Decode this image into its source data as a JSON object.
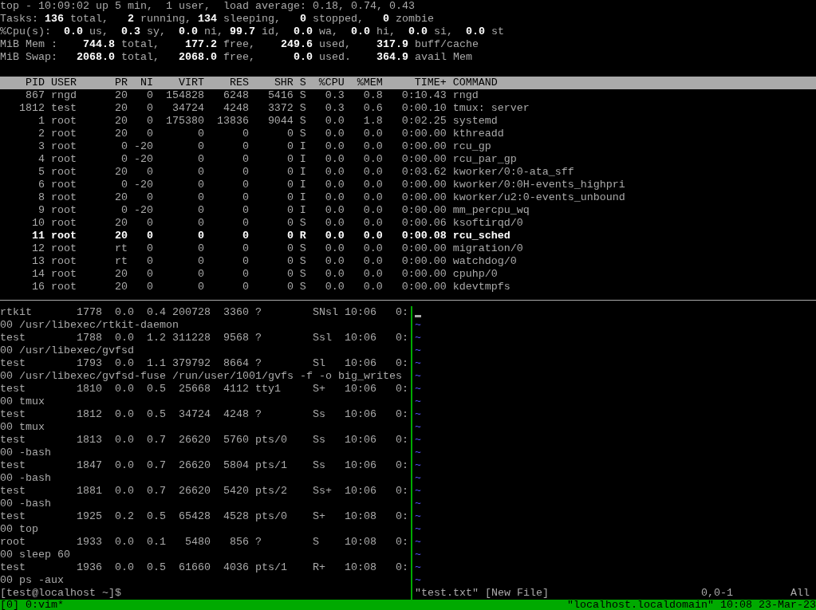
{
  "top": {
    "summary": [
      "top - 10:09:02 up 5 min,  1 user,  load average: 0.18, 0.74, 0.43",
      "Tasks: **136** total,   **2** running, **134** sleeping,   **0** stopped,   **0** zombie",
      "%Cpu(s):  **0.0** us,  **0.3** sy,  **0.0** ni, **99.7** id,  **0.0** wa,  **0.0** hi,  **0.0** si,  **0.0** st",
      "MiB Mem :    **744.8** total,    **177.2** free,    **249.6** used,    **317.9** buff/cache",
      "MiB Swap:   **2068.0** total,   **2068.0** free,      **0.0** used.    **364.9** avail Mem"
    ],
    "columns": [
      "PID",
      "USER",
      "PR",
      "NI",
      "VIRT",
      "RES",
      "SHR",
      "S",
      "%CPU",
      "%MEM",
      "TIME+",
      "COMMAND"
    ],
    "rows": [
      {
        "cells": [
          "867",
          "rngd",
          "20",
          "0",
          "154828",
          "6248",
          "5416",
          "S",
          "0.3",
          "0.8",
          "0:10.43",
          "rngd"
        ],
        "running": false
      },
      {
        "cells": [
          "1812",
          "test",
          "20",
          "0",
          "34724",
          "4248",
          "3372",
          "S",
          "0.3",
          "0.6",
          "0:00.10",
          "tmux: server"
        ],
        "running": false
      },
      {
        "cells": [
          "1",
          "root",
          "20",
          "0",
          "175380",
          "13836",
          "9044",
          "S",
          "0.0",
          "1.8",
          "0:02.25",
          "systemd"
        ],
        "running": false
      },
      {
        "cells": [
          "2",
          "root",
          "20",
          "0",
          "0",
          "0",
          "0",
          "S",
          "0.0",
          "0.0",
          "0:00.00",
          "kthreadd"
        ],
        "running": false
      },
      {
        "cells": [
          "3",
          "root",
          "0",
          "-20",
          "0",
          "0",
          "0",
          "I",
          "0.0",
          "0.0",
          "0:00.00",
          "rcu_gp"
        ],
        "running": false
      },
      {
        "cells": [
          "4",
          "root",
          "0",
          "-20",
          "0",
          "0",
          "0",
          "I",
          "0.0",
          "0.0",
          "0:00.00",
          "rcu_par_gp"
        ],
        "running": false
      },
      {
        "cells": [
          "5",
          "root",
          "20",
          "0",
          "0",
          "0",
          "0",
          "I",
          "0.0",
          "0.0",
          "0:03.62",
          "kworker/0:0-ata_sff"
        ],
        "running": false
      },
      {
        "cells": [
          "6",
          "root",
          "0",
          "-20",
          "0",
          "0",
          "0",
          "I",
          "0.0",
          "0.0",
          "0:00.00",
          "kworker/0:0H-events_highpri"
        ],
        "running": false
      },
      {
        "cells": [
          "8",
          "root",
          "20",
          "0",
          "0",
          "0",
          "0",
          "I",
          "0.0",
          "0.0",
          "0:00.00",
          "kworker/u2:0-events_unbound"
        ],
        "running": false
      },
      {
        "cells": [
          "9",
          "root",
          "0",
          "-20",
          "0",
          "0",
          "0",
          "I",
          "0.0",
          "0.0",
          "0:00.00",
          "mm_percpu_wq"
        ],
        "running": false
      },
      {
        "cells": [
          "10",
          "root",
          "20",
          "0",
          "0",
          "0",
          "0",
          "S",
          "0.0",
          "0.0",
          "0:00.06",
          "ksoftirqd/0"
        ],
        "running": false
      },
      {
        "cells": [
          "11",
          "root",
          "20",
          "0",
          "0",
          "0",
          "0",
          "R",
          "0.0",
          "0.0",
          "0:00.08",
          "rcu_sched"
        ],
        "running": true
      },
      {
        "cells": [
          "12",
          "root",
          "rt",
          "0",
          "0",
          "0",
          "0",
          "S",
          "0.0",
          "0.0",
          "0:00.00",
          "migration/0"
        ],
        "running": false
      },
      {
        "cells": [
          "13",
          "root",
          "rt",
          "0",
          "0",
          "0",
          "0",
          "S",
          "0.0",
          "0.0",
          "0:00.00",
          "watchdog/0"
        ],
        "running": false
      },
      {
        "cells": [
          "14",
          "root",
          "20",
          "0",
          "0",
          "0",
          "0",
          "S",
          "0.0",
          "0.0",
          "0:00.00",
          "cpuhp/0"
        ],
        "running": false
      },
      {
        "cells": [
          "16",
          "root",
          "20",
          "0",
          "0",
          "0",
          "0",
          "S",
          "0.0",
          "0.0",
          "0:00.00",
          "kdevtmpfs"
        ],
        "running": false
      }
    ]
  },
  "shell": {
    "lines": [
      "rtkit       1778  0.0  0.4 200728  3360 ?        SNsl 10:06   0:",
      "00 /usr/libexec/rtkit-daemon",
      "test        1788  0.0  1.2 311228  9568 ?        Ssl  10:06   0:",
      "00 /usr/libexec/gvfsd",
      "test        1793  0.0  1.1 379792  8664 ?        Sl   10:06   0:",
      "00 /usr/libexec/gvfsd-fuse /run/user/1001/gvfs -f -o big_writes",
      "test        1810  0.0  0.5  25668  4112 tty1     S+   10:06   0:",
      "00 tmux",
      "test        1812  0.0  0.5  34724  4248 ?        Ss   10:06   0:",
      "00 tmux",
      "test        1813  0.0  0.7  26620  5760 pts/0    Ss   10:06   0:",
      "00 -bash",
      "test        1847  0.0  0.7  26620  5804 pts/1    Ss   10:06   0:",
      "00 -bash",
      "test        1881  0.0  0.7  26620  5420 pts/2    Ss+  10:06   0:",
      "00 -bash",
      "test        1925  0.2  0.5  65428  4528 pts/0    S+   10:08   0:",
      "00 top",
      "root        1933  0.0  0.1   5480   856 ?        S    10:08   0:",
      "00 sleep 60",
      "test        1936  0.0  0.5  61660  4036 pts/1    R+   10:08   0:",
      "00 ps -aux",
      "[test@localhost ~]$"
    ]
  },
  "vim": {
    "active": true,
    "tildes": [
      "~",
      "~",
      "~",
      "~",
      "~",
      "~",
      "~",
      "~",
      "~",
      "~",
      "~",
      "~",
      "~",
      "~",
      "~",
      "~",
      "~",
      "~",
      "~",
      "~",
      "~"
    ],
    "message": "\"test.txt\" [New File]",
    "position": "0,0-1",
    "scroll": "All"
  },
  "status_bar": {
    "session": "[0] 0:vim*",
    "right": "\"localhost.localdomain\" 10:08 23-Mar-23"
  }
}
